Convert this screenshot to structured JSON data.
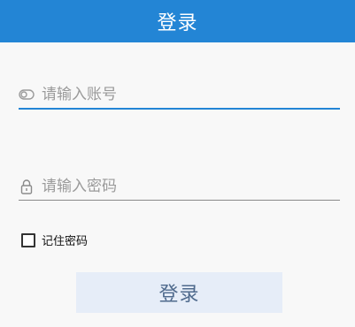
{
  "header": {
    "title": "登录"
  },
  "form": {
    "account": {
      "icon": "account-toggle-icon",
      "value": "",
      "placeholder": "请输入账号"
    },
    "password": {
      "icon": "lock-icon",
      "value": "",
      "placeholder": "请输入密码"
    },
    "remember": {
      "label": "记住密码",
      "checked": false
    },
    "submit_label": "登录"
  },
  "colors": {
    "header_bg": "#2385d5",
    "active_underline": "#2385d5",
    "button_bg": "#e6edf8",
    "button_text": "#4f6a8d"
  }
}
